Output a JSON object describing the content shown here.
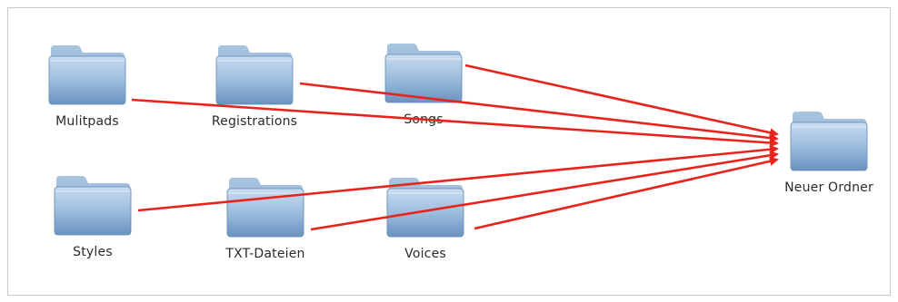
{
  "folders": {
    "mulitpads": {
      "label": "Mulitpads",
      "icon": "folder-icon"
    },
    "registrations": {
      "label": "Registrations",
      "icon": "folder-icon"
    },
    "songs": {
      "label": "Songs",
      "icon": "folder-icon"
    },
    "styles": {
      "label": "Styles",
      "icon": "folder-icon"
    },
    "txt_dateien": {
      "label": "TXT-Dateien",
      "icon": "folder-icon"
    },
    "voices": {
      "label": "Voices",
      "icon": "folder-icon"
    },
    "neuer_ordner": {
      "label": "Neuer Ordner",
      "icon": "folder-icon"
    }
  },
  "colors": {
    "arrow": "#e8231c",
    "folder_body_top": "#b9d3ea",
    "folder_body_bottom": "#6f98c3",
    "folder_tab": "#9fbedc"
  }
}
